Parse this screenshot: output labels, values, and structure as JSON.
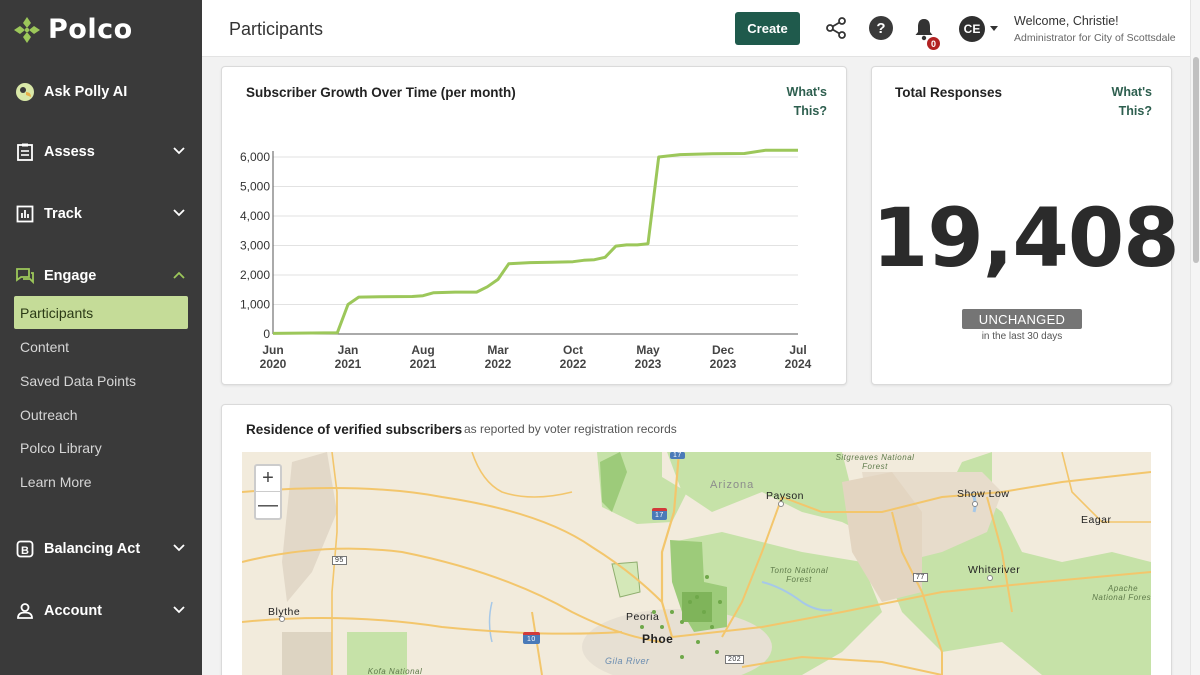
{
  "app": {
    "brand": "Polco",
    "page_title": "Participants"
  },
  "sidebar": {
    "ask_ai": "Ask Polly AI",
    "sections": [
      {
        "label": "Assess",
        "icon": "clipboard-icon"
      },
      {
        "label": "Track",
        "icon": "bar-chart-icon"
      },
      {
        "label": "Engage",
        "icon": "chat-bubbles-icon"
      },
      {
        "label": "Balancing Act",
        "icon": "balancing-act-icon"
      },
      {
        "label": "Account",
        "icon": "person-icon"
      }
    ],
    "engage_items": [
      "Participants",
      "Content",
      "Saved Data Points",
      "Outreach",
      "Polco Library",
      "Learn More"
    ],
    "active_item": "Participants"
  },
  "header": {
    "create_label": "Create",
    "notification_count": "0",
    "avatar_initials": "CE",
    "welcome": "Welcome, Christie!",
    "role": "Administrator for City of Scottsdale"
  },
  "growth_card": {
    "title": "Subscriber Growth Over Time (per month)",
    "whats_this_1": "What's",
    "whats_this_2": "This?"
  },
  "total_card": {
    "title": "Total Responses",
    "whats_this_1": "What's",
    "whats_this_2": "This?",
    "value": "19,408",
    "status": "UNCHANGED",
    "period": "in the last 30 days"
  },
  "map_card": {
    "title": "Residence of verified subscribers",
    "subtitle": "as reported by voter registration records",
    "zoom_in": "+",
    "zoom_out": "—",
    "labels": {
      "sitgreaves": "Sitgreaves National Forest",
      "arizona": "Arizona",
      "payson": "Payson",
      "show_low": "Show Low",
      "eagar": "Eagar",
      "tonto": "Tonto National Forest",
      "whiteriver": "Whiteriver",
      "apache": "Apache National Forest",
      "blythe": "Blythe",
      "peoria": "Peoria",
      "phoenix": "Phoe",
      "gila": "Gila River",
      "kofa": "Kofa National",
      "hwy17": "17",
      "hwy17b": "17",
      "hwy95": "95",
      "hwy77": "77",
      "hwy10": "10",
      "hwy202": "202"
    }
  },
  "colors": {
    "sidebar_bg": "#3a3a3a",
    "active_item_bg": "#c5dc98",
    "brand_green": "#1f5a4c",
    "chart_line": "#9cc75a"
  },
  "chart_data": {
    "type": "line",
    "title": "Subscriber Growth Over Time (per month)",
    "xlabel": "",
    "ylabel": "",
    "x_ticks": [
      "Jun 2020",
      "Jan 2021",
      "Aug 2021",
      "Mar 2022",
      "Oct 2022",
      "May 2023",
      "Dec 2023",
      "Jul 2024"
    ],
    "y_ticks": [
      0,
      1000,
      2000,
      3000,
      4000,
      5000,
      6000
    ],
    "y_tick_labels": [
      "0",
      "1,000",
      "2,000",
      "3,000",
      "4,000",
      "5,000",
      "6,000"
    ],
    "ylim": [
      0,
      6000
    ],
    "grid": true,
    "x": [
      "2020-06",
      "2020-12",
      "2021-01",
      "2021-02",
      "2021-04",
      "2021-07",
      "2021-08",
      "2021-09",
      "2021-11",
      "2022-01",
      "2022-02",
      "2022-03",
      "2022-04",
      "2022-06",
      "2022-08",
      "2022-09",
      "2022-10",
      "2022-11",
      "2022-12",
      "2023-01",
      "2023-02",
      "2023-03",
      "2023-04",
      "2023-05",
      "2023-06",
      "2023-08",
      "2023-11",
      "2024-02",
      "2024-04",
      "2024-07"
    ],
    "y": [
      20,
      40,
      1000,
      1250,
      1260,
      1270,
      1300,
      1400,
      1420,
      1420,
      1600,
      1850,
      2380,
      2420,
      2430,
      2440,
      2450,
      2500,
      2520,
      2600,
      2980,
      3020,
      3020,
      3060,
      6000,
      6080,
      6110,
      6120,
      6230,
      6230
    ]
  }
}
